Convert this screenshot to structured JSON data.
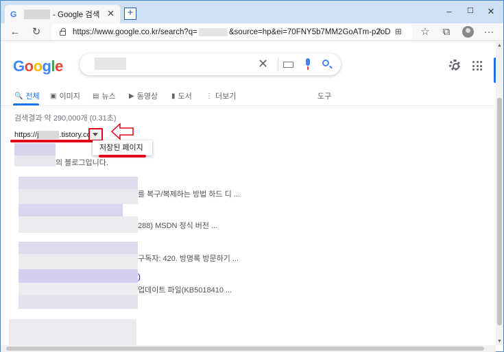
{
  "browser": {
    "tab_title": "- Google 검색",
    "tab_close": "✕",
    "newtab": "+",
    "window_minimize": "–",
    "window_maximize": "☐",
    "window_close": "✕",
    "url_prefix": "https://www.google.co.kr/search?q=",
    "url_suffix": "&source=hp&ei=70FNY5b7MM2GoATm-p2oDw&if...",
    "back": "←",
    "refresh": "↻",
    "read_aloud": "A",
    "extensions": "⊞",
    "favorites": "☆",
    "collections": "⧉",
    "menu": "···"
  },
  "google": {
    "logo_letters": [
      {
        "ch": "G",
        "color": "#4285f4"
      },
      {
        "ch": "o",
        "color": "#ea4335"
      },
      {
        "ch": "o",
        "color": "#fbbc05"
      },
      {
        "ch": "g",
        "color": "#4285f4"
      },
      {
        "ch": "l",
        "color": "#34a853"
      },
      {
        "ch": "e",
        "color": "#ea4335"
      }
    ],
    "search_clear": "✕",
    "tabs": [
      {
        "icon": "🔍",
        "label": "전체"
      },
      {
        "icon": "▣",
        "label": "이미지"
      },
      {
        "icon": "▤",
        "label": "뉴스"
      },
      {
        "icon": "▶",
        "label": "동영상"
      },
      {
        "icon": "▮",
        "label": "도서"
      },
      {
        "icon": "⋮",
        "label": "더보기"
      },
      {
        "icon": "",
        "label": "도구"
      }
    ],
    "stats": "검색결과 약 290,000개 (0.31초)"
  },
  "result": {
    "cite_prefix": "https://j",
    "cite_suffix": ".tistory.com",
    "menu_item": "저장된 페이지",
    "snippets": [
      "의 블로그입니다.",
      "를 복구/복제하는 방법 하드 디 ...",
      "288) MSDN 정식 버전 ...",
      "구독자: 420. 방명록 방문하기 ...",
      "업데이트 파일(KB5018410 ..."
    ],
    "links": [
      ")",
      ")"
    ]
  },
  "colors": {
    "accent": "#1a73e8",
    "annotation_red": "#e2001a",
    "link": "#1a0dab"
  }
}
